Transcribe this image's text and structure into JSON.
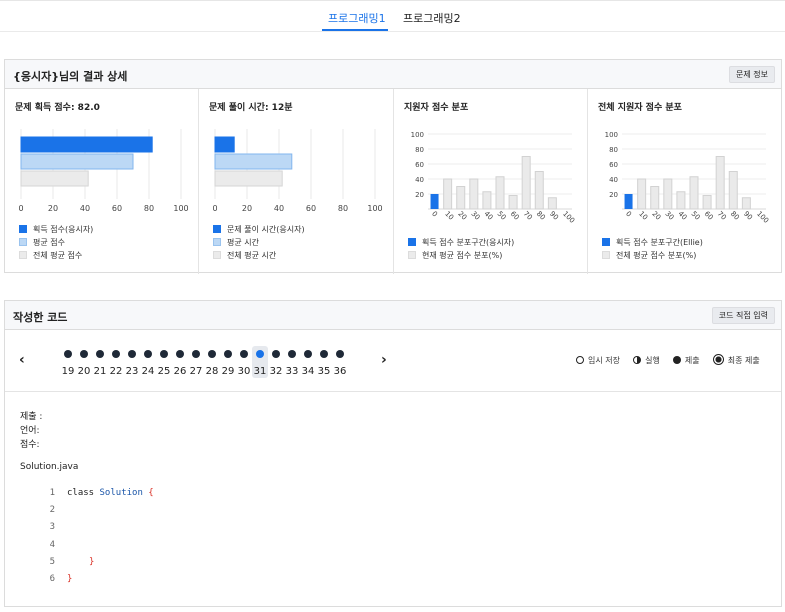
{
  "tabs": [
    {
      "label": "프로그래밍1",
      "active": true
    },
    {
      "label": "프로그래밍2",
      "active": false
    }
  ],
  "result": {
    "title": "{응시자}님의 결과 상세",
    "info_button": "문제 정보",
    "columns": [
      {
        "title": "문제 획득 점수: 82.0",
        "legend": [
          "획득 점수(응시자)",
          "평균 점수",
          "전체 평균 점수"
        ]
      },
      {
        "title": "문제 풀이 시간: 12분",
        "legend": [
          "문제 풀이 시간(응시자)",
          "평균 시간",
          "전체 평균 시간"
        ]
      },
      {
        "title": "지원자 점수 분포",
        "legend": [
          "획득 점수 분포구간(응시자)",
          "현재 평균 점수 분포(%)"
        ]
      },
      {
        "title": "전체 지원자 점수 분포",
        "legend": [
          "획득 점수 분포구간(Ellie)",
          "전체 평균 점수 분포(%)"
        ]
      }
    ]
  },
  "chart_data": [
    {
      "type": "bar",
      "orientation": "horizontal",
      "categories": [
        "획득 점수(응시자)",
        "평균 점수",
        "전체 평균 점수"
      ],
      "values": [
        82,
        70,
        42
      ],
      "xlim": [
        0,
        100
      ],
      "xticks": [
        "0",
        "20",
        "40",
        "60",
        "80",
        "100"
      ],
      "colors": [
        "#1a73e8",
        "#bcd8f5",
        "#ebebeb"
      ]
    },
    {
      "type": "bar",
      "orientation": "horizontal",
      "categories": [
        "문제 풀이 시간(응시자)",
        "평균 시간",
        "전체 평균 시간"
      ],
      "values": [
        12,
        48,
        42
      ],
      "xlim": [
        0,
        100
      ],
      "xticks": [
        "0",
        "20",
        "40",
        "60",
        "80",
        "100"
      ],
      "colors": [
        "#1a73e8",
        "#bcd8f5",
        "#ebebeb"
      ]
    },
    {
      "type": "bar",
      "categories": [
        "0",
        "10",
        "20",
        "30",
        "40",
        "50",
        "60",
        "70",
        "80",
        "90",
        "100"
      ],
      "series": [
        {
          "name": "획득 점수 분포구간(응시자)",
          "values": [
            20,
            0,
            0,
            0,
            0,
            0,
            0,
            0,
            0,
            0,
            0
          ]
        },
        {
          "name": "현재 평균 점수 분포(%)",
          "values": [
            0,
            40,
            30,
            40,
            23,
            43,
            18,
            70,
            50,
            15,
            0
          ]
        }
      ],
      "ylim": [
        0,
        100
      ],
      "yticks": [
        "20",
        "40",
        "60",
        "80",
        "100"
      ],
      "highlight_index": 0
    },
    {
      "type": "bar",
      "categories": [
        "0",
        "10",
        "20",
        "30",
        "40",
        "50",
        "60",
        "70",
        "80",
        "90",
        "100"
      ],
      "series": [
        {
          "name": "획득 점수 분포구간(Ellie)",
          "values": [
            20,
            0,
            0,
            0,
            0,
            0,
            0,
            0,
            0,
            0,
            0
          ]
        },
        {
          "name": "전체 평균 점수 분포(%)",
          "values": [
            0,
            40,
            30,
            40,
            23,
            43,
            18,
            70,
            50,
            15,
            0
          ]
        }
      ],
      "ylim": [
        0,
        100
      ],
      "yticks": [
        "20",
        "40",
        "60",
        "80",
        "100"
      ],
      "highlight_index": 0
    }
  ],
  "code": {
    "title": "작성한 코드",
    "direct_input_button": "코드 직접 입력",
    "prev": "‹",
    "next": "›",
    "submissions": [
      "19",
      "20",
      "21",
      "22",
      "23",
      "24",
      "25",
      "26",
      "27",
      "28",
      "29",
      "30",
      "31",
      "32",
      "33",
      "34",
      "35",
      "36"
    ],
    "selected_submission": "31",
    "status_legend": [
      {
        "label": "임시 저장",
        "icon": "open-circle-icon"
      },
      {
        "label": "실행",
        "icon": "half-circle-icon"
      },
      {
        "label": "제출",
        "icon": "filled-circle-icon"
      },
      {
        "label": "최종 제출",
        "icon": "ring-circle-icon"
      }
    ],
    "meta": {
      "submit": "제출 :",
      "language": "언어:",
      "score": "점수:"
    },
    "filename": "Solution.java",
    "lines": [
      {
        "n": "1",
        "kw": "class",
        "name": "Solution",
        "brace": "{"
      },
      {
        "n": "2"
      },
      {
        "n": "3"
      },
      {
        "n": "4"
      },
      {
        "n": "5",
        "brace": "}"
      },
      {
        "n": "6",
        "brace": "}"
      }
    ]
  }
}
